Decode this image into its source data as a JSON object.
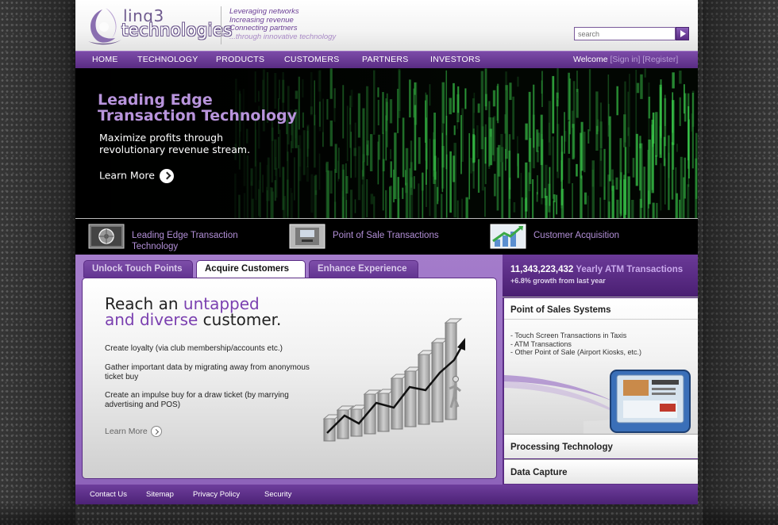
{
  "brand": {
    "logo_line1": "linq3",
    "logo_line2": "technologies",
    "taglines": [
      "Leveraging networks",
      "Increasing revenue",
      "Connecting partners",
      "...through innovative technology"
    ]
  },
  "search": {
    "placeholder": "search"
  },
  "nav": {
    "items": [
      "HOME",
      "TECHNOLOGY",
      "PRODUCTS",
      "CUSTOMERS",
      "PARTNERS",
      "INVESTORS"
    ],
    "welcome": "Welcome",
    "sign_in": "[Sign in]",
    "register": "[Register]"
  },
  "hero": {
    "title_line1": "Leading Edge",
    "title_line2": "Transaction Technology",
    "subtitle": "Maximize profits through revolutionary revenue stream.",
    "learn_more": "Learn More"
  },
  "features": [
    {
      "label": "Leading Edge Transaction Technology",
      "icon": "vault-icon"
    },
    {
      "label": "Point of Sale Transactions",
      "icon": "atm-icon"
    },
    {
      "label": "Customer Acquisition",
      "icon": "growth-chart-icon"
    }
  ],
  "tabs": [
    {
      "label": "Unlock Touch Points",
      "active": false
    },
    {
      "label": "Acquire Customers",
      "active": true
    },
    {
      "label": "Enhance Experience",
      "active": false
    }
  ],
  "content": {
    "title_part1": "Reach an ",
    "title_hl1": "untapped",
    "title_hl2": "and diverse",
    "title_part2": " customer.",
    "paragraphs": [
      "Create loyalty (via club membership/accounts etc.)",
      "Gather important data by migrating away from anonymous ticket buy",
      "Create an impulse buy for a draw ticket (by marrying advertising and POS)"
    ],
    "learn_more": "Learn More"
  },
  "sidebar": {
    "stat_number": "11,343,223,432",
    "stat_label": "Yearly ATM Transactions",
    "stat_growth": "+6.8% growth from last year",
    "pos_title": "Point of Sales Systems",
    "pos_items": [
      "- Touch Screen Transactions in Taxis",
      "- ATM Transactions",
      "- Other Point of Sale (Airport Kiosks, etc.)"
    ],
    "links": [
      "Processing Technology",
      "Data Capture"
    ]
  },
  "footer": {
    "links": [
      "Contact Us",
      "Sitemap",
      "Privacy Policy",
      "Security"
    ]
  },
  "colors": {
    "accent_purple": "#5a2c84",
    "highlight_purple": "#7a3fb0",
    "hero_green": "#39c84a"
  }
}
